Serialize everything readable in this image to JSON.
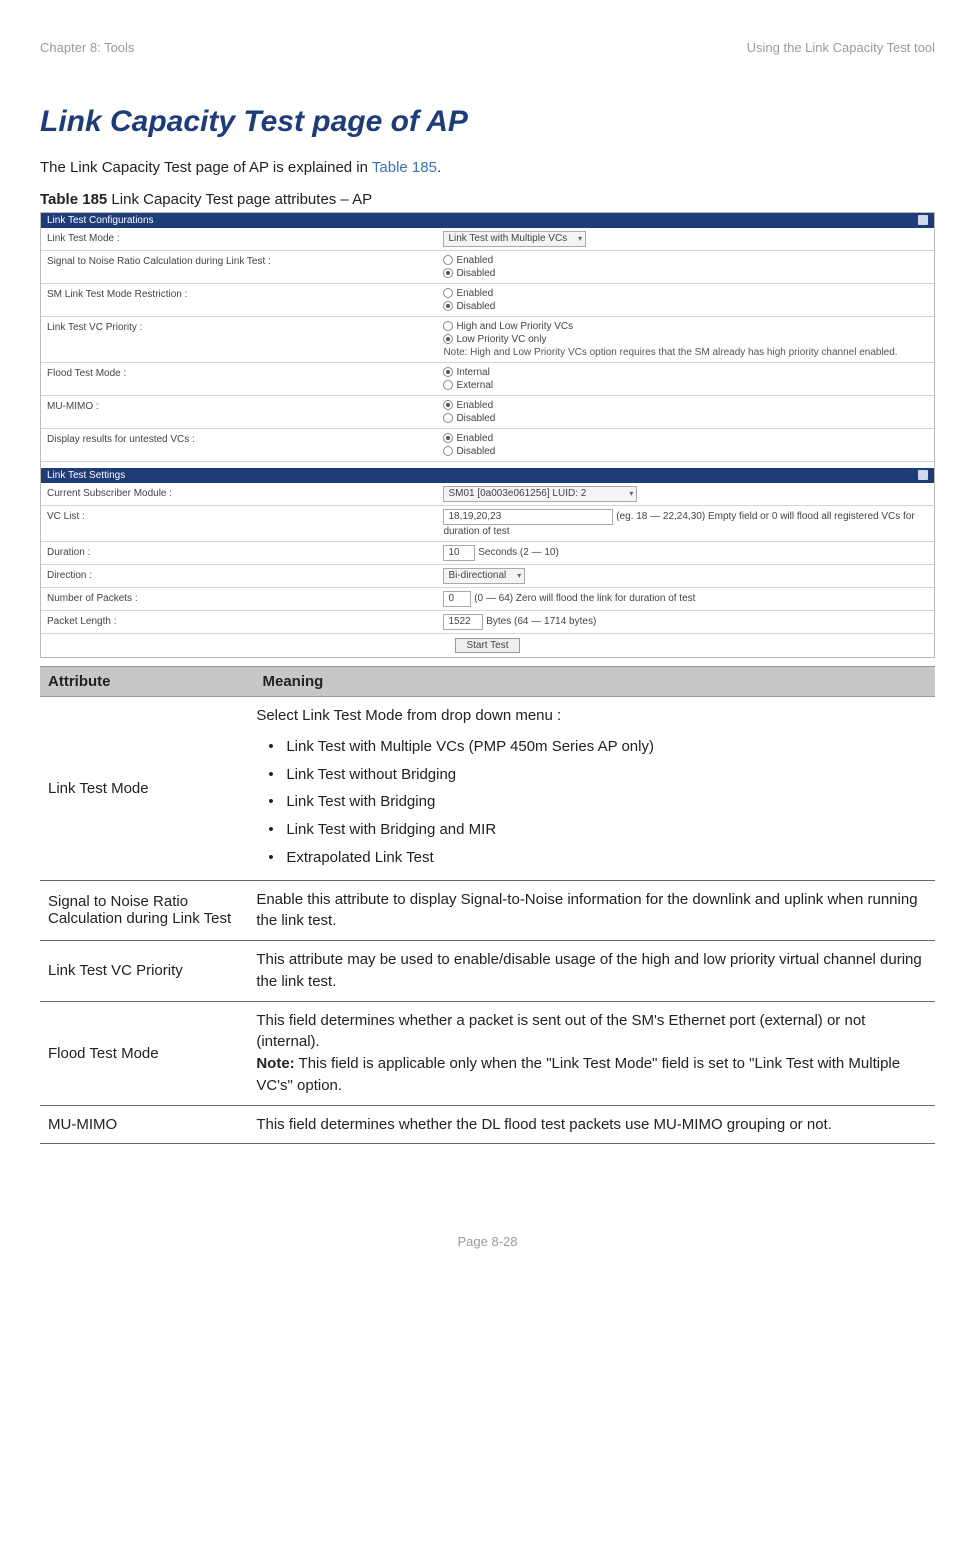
{
  "header": {
    "left": "Chapter 8:  Tools",
    "right": "Using the Link Capacity Test tool"
  },
  "title": "Link Capacity Test page of AP",
  "intro_prefix": "The Link Capacity Test page of AP is explained in ",
  "intro_link": "Table 185",
  "intro_suffix": ".",
  "caption_bold": "Table 185",
  "caption_rest": " Link Capacity Test page attributes – AP",
  "shot": {
    "config_title": "Link Test Configurations",
    "rows": {
      "ltm": {
        "label": "Link Test Mode :",
        "value": "Link Test with Multiple VCs"
      },
      "snr": {
        "label": "Signal to Noise Ratio Calculation during Link Test :",
        "opt1": "Enabled",
        "opt2": "Disabled"
      },
      "smr": {
        "label": "SM Link Test Mode Restriction :",
        "opt1": "Enabled",
        "opt2": "Disabled"
      },
      "vcp": {
        "label": "Link Test VC Priority :",
        "opt1": "High and Low Priority VCs",
        "opt2": "Low Priority VC only",
        "note": "Note: High and Low Priority VCs option requires that the SM already has high priority channel enabled."
      },
      "ftm": {
        "label": "Flood Test Mode :",
        "opt1": "Internal",
        "opt2": "External"
      },
      "mumimo": {
        "label": "MU-MIMO :",
        "opt1": "Enabled",
        "opt2": "Disabled"
      },
      "dru": {
        "label": "Display results for untested VCs :",
        "opt1": "Enabled",
        "opt2": "Disabled"
      }
    },
    "settings_title": "Link Test Settings",
    "settings": {
      "csm": {
        "label": "Current Subscriber Module :",
        "value": "SM01 [0a003e061256] LUID: 2"
      },
      "vclist": {
        "label": "VC List :",
        "value": "18,19,20,23",
        "hint": "(eg. 18 — 22,24,30) Empty field or 0 will flood all registered VCs for duration of test"
      },
      "dur": {
        "label": "Duration :",
        "value": "10",
        "hint": "Seconds (2 — 10)"
      },
      "dir": {
        "label": "Direction :",
        "value": "Bi-directional"
      },
      "npk": {
        "label": "Number of Packets :",
        "value": "0",
        "hint": "(0 — 64) Zero will flood the link for duration of test"
      },
      "plen": {
        "label": "Packet Length :",
        "value": "1522",
        "hint": "Bytes (64 — 1714 bytes)"
      },
      "start": "Start Test"
    }
  },
  "table": {
    "hdr_attr": "Attribute",
    "hdr_mean": "Meaning",
    "rows": [
      {
        "attr": "Link Test Mode",
        "lead": "Select Link Test Mode from drop down menu :",
        "items": [
          "Link Test with Multiple VCs (PMP 450m Series AP only)",
          "Link Test without Bridging",
          "Link Test with Bridging",
          "Link Test with Bridging and MIR",
          "Extrapolated Link Test"
        ]
      },
      {
        "attr": "Signal to Noise Ratio Calculation during Link Test",
        "text": "Enable this attribute to display Signal-to-Noise information for the downlink and uplink when running the link test."
      },
      {
        "attr": "Link Test VC Priority",
        "text": "This attribute may be used to enable/disable usage of the high and low priority virtual channel during the link test."
      },
      {
        "attr": "Flood Test Mode",
        "para1": "This field determines whether a packet is sent out of the SM's Ethernet port (external)  or not (internal).",
        "note_lbl": "Note:",
        "note_txt": " This field is applicable only when the \"Link Test Mode\" field is set to \"Link Test with Multiple VC's\" option."
      },
      {
        "attr": "MU-MIMO",
        "text": "This field determines whether the DL flood test packets use MU-MIMO grouping or not."
      }
    ]
  },
  "footer": "Page 8-28"
}
